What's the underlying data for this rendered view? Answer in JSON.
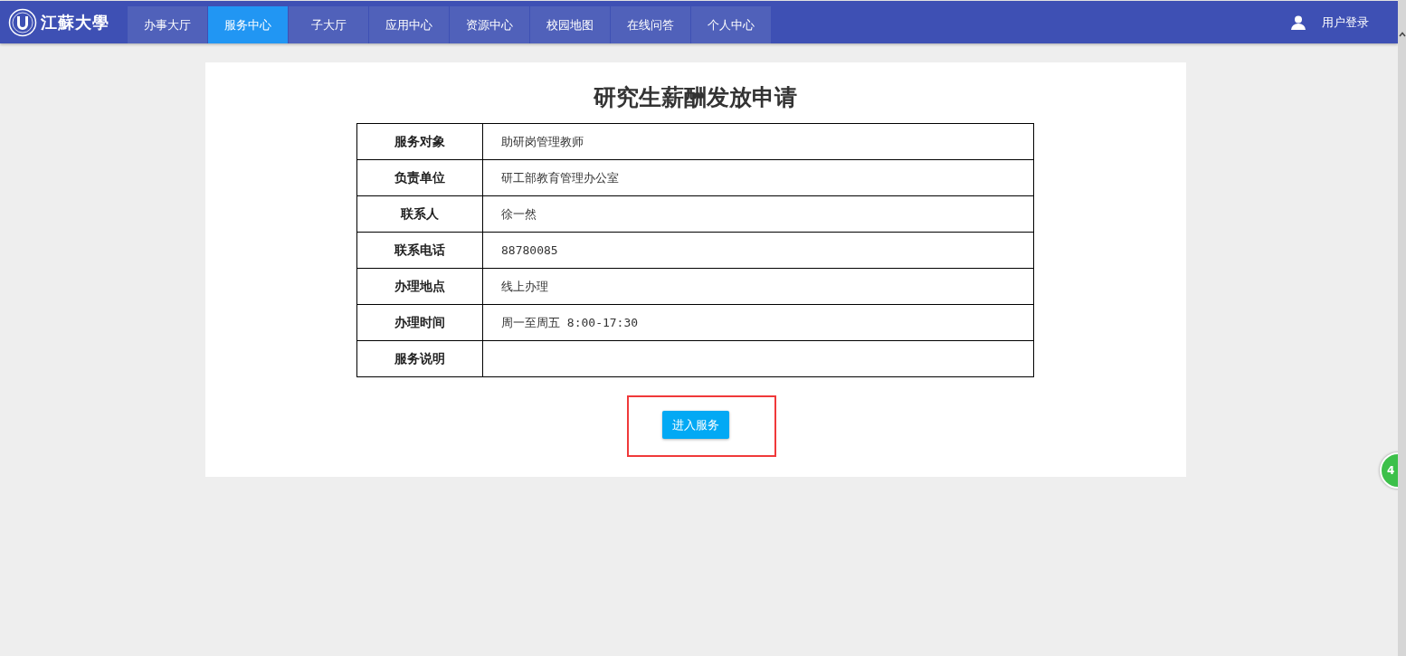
{
  "header": {
    "logo_text": "江蘇大學",
    "nav": [
      {
        "label": "办事大厅",
        "selected": false
      },
      {
        "label": "服务中心",
        "selected": true
      },
      {
        "label": "子大厅",
        "selected": false
      },
      {
        "label": "应用中心",
        "selected": false
      },
      {
        "label": "资源中心",
        "selected": false
      },
      {
        "label": "校园地图",
        "selected": false
      },
      {
        "label": "在线问答",
        "selected": false
      },
      {
        "label": "个人中心",
        "selected": false
      }
    ],
    "login": "用户登录"
  },
  "title": "研究生薪酬发放申请",
  "table": {
    "rows": [
      {
        "label": "服务对象",
        "value": "助研岗管理教师"
      },
      {
        "label": "负责单位",
        "value": "研工部教育管理办公室"
      },
      {
        "label": "联系人",
        "value": "徐一然"
      },
      {
        "label": "联系电话",
        "value": "88780085"
      },
      {
        "label": "办理地点",
        "value": "线上办理"
      },
      {
        "label": "办理时间",
        "value": "周一至周五 8:00-17:30"
      },
      {
        "label": "服务说明",
        "value": ""
      }
    ]
  },
  "button": {
    "label": "进入服务",
    "highlighted": true
  },
  "floating_badge": "4"
}
